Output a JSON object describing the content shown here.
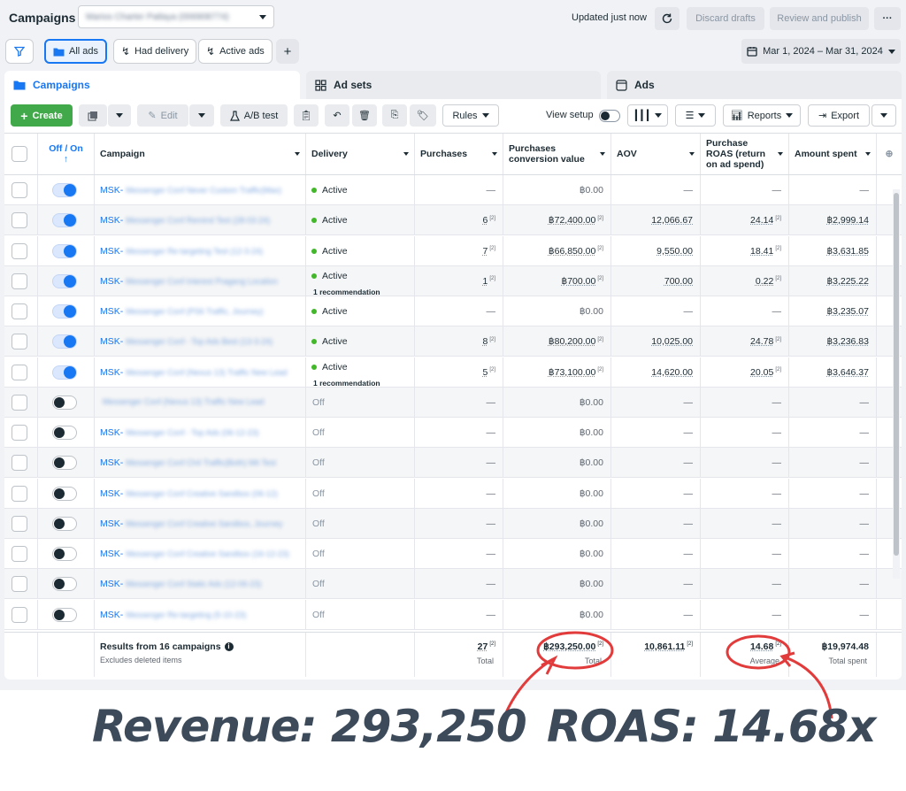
{
  "topbar": {
    "title": "Campaigns",
    "account_value": "Marios Charter Patlaya (006908774)",
    "updated": "Updated just now",
    "discard": "Discard drafts",
    "review": "Review and publish",
    "more": "···"
  },
  "filters": {
    "all_ads": "All ads",
    "had_delivery": "Had delivery",
    "active_ads": "Active ads",
    "add": "+",
    "date_range": "Mar 1, 2024 – Mar 31, 2024"
  },
  "tabs": {
    "campaigns": "Campaigns",
    "ad_sets": "Ad sets",
    "ads": "Ads"
  },
  "toolbar": {
    "create": "Create",
    "edit": "Edit",
    "ab_test": "A/B test",
    "rules": "Rules",
    "view_setup": "View setup",
    "reports": "Reports",
    "export": "Export"
  },
  "columns": {
    "offon": "Off / On",
    "campaign": "Campaign",
    "delivery": "Delivery",
    "purchases": "Purchases",
    "pcv_line1": "Purchases",
    "pcv_line2": "conversion value",
    "aov": "AOV",
    "roas_line1": "Purchase",
    "roas_line2": "ROAS (return",
    "roas_line3": "on ad spend)",
    "amount_spent": "Amount spent"
  },
  "rows": [
    {
      "on": true,
      "prefix": "MSK-",
      "name": "Messenger Conf Never Custom Traffic(Max)",
      "delivery": "Active",
      "rec": "",
      "purchases": "—",
      "purchases_note": "",
      "value": "฿0.00",
      "value_note": "",
      "aov": "—",
      "roas": "—",
      "roas_note": "",
      "spent": "—"
    },
    {
      "on": true,
      "prefix": "MSK-",
      "name": "Messenger Conf Remind Test (28-03-24)",
      "delivery": "Active",
      "rec": "",
      "purchases": "6",
      "purchases_note": "[2]",
      "value": "฿72,400.00",
      "value_note": "[2]",
      "aov": "12,066.67",
      "roas": "24.14",
      "roas_note": "[2]",
      "spent": "฿2,999.14"
    },
    {
      "on": true,
      "prefix": "MSK-",
      "name": "Messenger Re-targeting Test (12-3-24)",
      "delivery": "Active",
      "rec": "",
      "purchases": "7",
      "purchases_note": "[2]",
      "value": "฿66,850.00",
      "value_note": "[2]",
      "aov": "9,550.00",
      "roas": "18.41",
      "roas_note": "[2]",
      "spent": "฿3,631.85"
    },
    {
      "on": true,
      "prefix": "MSK-",
      "name": "Messenger Conf Interest Pragang Location",
      "delivery": "Active",
      "rec": "1 recommendation",
      "purchases": "1",
      "purchases_note": "[2]",
      "value": "฿700.00",
      "value_note": "[2]",
      "aov": "700.00",
      "roas": "0.22",
      "roas_note": "[2]",
      "spent": "฿3,225.22"
    },
    {
      "on": true,
      "prefix": "MSK-",
      "name": "Messenger Conf (PS6 Traffic, Journey)",
      "delivery": "Active",
      "rec": "",
      "purchases": "—",
      "purchases_note": "",
      "value": "฿0.00",
      "value_note": "",
      "aov": "—",
      "roas": "—",
      "roas_note": "",
      "spent": "฿3,235.07"
    },
    {
      "on": true,
      "prefix": "MSK-",
      "name": "Messenger Conf - Top Ads Best (13-3-24)",
      "delivery": "Active",
      "rec": "",
      "purchases": "8",
      "purchases_note": "[2]",
      "value": "฿80,200.00",
      "value_note": "[2]",
      "aov": "10,025.00",
      "roas": "24.78",
      "roas_note": "[2]",
      "spent": "฿3,236.83"
    },
    {
      "on": true,
      "prefix": "MSK-",
      "name": "Messenger Conf (Nexus 13) Traffic New Lead",
      "delivery": "Active",
      "rec": "1 recommendation",
      "purchases": "5",
      "purchases_note": "[2]",
      "value": "฿73,100.00",
      "value_note": "[2]",
      "aov": "14,620.00",
      "roas": "20.05",
      "roas_note": "[2]",
      "spent": "฿3,646.37"
    },
    {
      "on": false,
      "prefix": "",
      "name": "Messenger Conf (Nexus 13) Traffic New Lead",
      "delivery": "Off",
      "rec": "",
      "purchases": "—",
      "purchases_note": "",
      "value": "฿0.00",
      "value_note": "",
      "aov": "—",
      "roas": "—",
      "roas_note": "",
      "spent": "—"
    },
    {
      "on": false,
      "prefix": "MSK-",
      "name": "Messenger Conf - Top Ads (06-12-23)",
      "delivery": "Off",
      "rec": "",
      "purchases": "—",
      "purchases_note": "",
      "value": "฿0.00",
      "value_note": "",
      "aov": "—",
      "roas": "—",
      "roas_note": "",
      "spent": "—"
    },
    {
      "on": false,
      "prefix": "MSK-",
      "name": "Messenger Conf Ch4 Traffic(Both) Mit Test",
      "delivery": "Off",
      "rec": "",
      "purchases": "—",
      "purchases_note": "",
      "value": "฿0.00",
      "value_note": "",
      "aov": "—",
      "roas": "—",
      "roas_note": "",
      "spent": "—"
    },
    {
      "on": false,
      "prefix": "MSK-",
      "name": "Messenger Conf Creative Sandbox (06-12)",
      "delivery": "Off",
      "rec": "",
      "purchases": "—",
      "purchases_note": "",
      "value": "฿0.00",
      "value_note": "",
      "aov": "—",
      "roas": "—",
      "roas_note": "",
      "spent": "—"
    },
    {
      "on": false,
      "prefix": "MSK-",
      "name": "Messenger Conf Creative Sandbox, Journey",
      "delivery": "Off",
      "rec": "",
      "purchases": "—",
      "purchases_note": "",
      "value": "฿0.00",
      "value_note": "",
      "aov": "—",
      "roas": "—",
      "roas_note": "",
      "spent": "—"
    },
    {
      "on": false,
      "prefix": "MSK-",
      "name": "Messenger Conf Creative Sandbox (16-12-23)",
      "delivery": "Off",
      "rec": "",
      "purchases": "—",
      "purchases_note": "",
      "value": "฿0.00",
      "value_note": "",
      "aov": "—",
      "roas": "—",
      "roas_note": "",
      "spent": "—"
    },
    {
      "on": false,
      "prefix": "MSK-",
      "name": "Messenger Conf Static Ads (12-06-23)",
      "delivery": "Off",
      "rec": "",
      "purchases": "—",
      "purchases_note": "",
      "value": "฿0.00",
      "value_note": "",
      "aov": "—",
      "roas": "—",
      "roas_note": "",
      "spent": "—"
    },
    {
      "on": false,
      "prefix": "MSK-",
      "name": "Messenger Re-targeting (5-10-23)",
      "delivery": "Off",
      "rec": "",
      "purchases": "—",
      "purchases_note": "",
      "value": "฿0.00",
      "value_note": "",
      "aov": "—",
      "roas": "—",
      "roas_note": "",
      "spent": "—"
    }
  ],
  "footer": {
    "title": "Results from 16 campaigns",
    "subtitle": "Excludes deleted items",
    "purchases": "27",
    "purchases_note": "[2]",
    "purchases_cap": "Total",
    "value": "฿293,250.00",
    "value_note": "[2]",
    "value_cap": "Total",
    "aov": "10,861.11",
    "aov_note": "[2]",
    "roas": "14.68",
    "roas_note": "[2]",
    "roas_cap": "Average",
    "spent": "฿19,974.48",
    "spent_cap": "Total spent"
  },
  "annotation": {
    "revenue": "Revenue: 293,250",
    "roas": "ROAS: 14.68x",
    "color": "#e23b3b"
  },
  "colors": {
    "accent": "#1877f2",
    "create": "#42a94a",
    "active_dot": "#42b72a"
  }
}
